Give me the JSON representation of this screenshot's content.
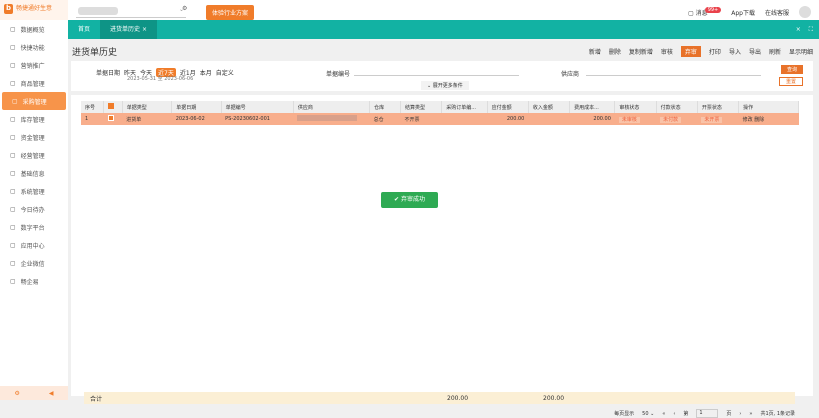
{
  "app": {
    "logo": "畅捷通好生意",
    "sub": "标准版"
  },
  "top": {
    "exp_btn": "体验行业方案",
    "msg": "消息",
    "msg_badge": "99+",
    "app": "App下载",
    "service": "在线客服"
  },
  "sidebar": {
    "items": [
      "数据概览",
      "快捷功能",
      "营销推广",
      "商品管理",
      "采购管理",
      "库存管理",
      "资金管理",
      "经营管理",
      "基础信息",
      "系统管理",
      "今日待办",
      "数字平台",
      "应用中心",
      "企业微信",
      "畅企易"
    ],
    "active": 4
  },
  "tabs": [
    {
      "label": "首页"
    },
    {
      "label": "进货单历史"
    }
  ],
  "page": {
    "title": "进货单历史"
  },
  "toolbar": [
    "新增",
    "删除",
    "复制新增",
    "审核",
    "弃审",
    "打印",
    "导入",
    "导出",
    "刷新",
    "显示明细"
  ],
  "filter": {
    "date_label": "单据日期",
    "ranges": [
      "昨天",
      "今天",
      "近7天",
      "近1月",
      "本月",
      "自定义"
    ],
    "active_range": 2,
    "date_text": "2023-05-31 至 2023-06-06",
    "no_label": "单据编号",
    "supplier_label": "供应商",
    "query": "查询",
    "reset": "重置",
    "more": "展开更多条件"
  },
  "table": {
    "headers": [
      "序号",
      "",
      "单据类型",
      "单据日期",
      "单据编号",
      "供应商",
      "仓库",
      "结算类型",
      "采购订单编...",
      "应付金额",
      "收入金额",
      "费用成本...",
      "审核状态",
      "付款状态",
      "开票状态",
      "操作"
    ],
    "rows": [
      [
        "1",
        "",
        "进货单",
        "2023-06-02",
        "PS-20230602-001",
        "",
        "总仓",
        "不开票",
        "",
        "200.00",
        "",
        "200.00",
        "未审核",
        "未付款",
        "未开票",
        "修改 删除"
      ]
    ]
  },
  "toast": "弃审成功",
  "summary": {
    "label": "合计",
    "amount": "200.00",
    "cost": "200.00"
  },
  "pager": {
    "per_page_label": "每页显示",
    "per_page": "50",
    "page_prefix": "第",
    "page": "1",
    "page_suffix": "页",
    "total": "共1页, 1条记录"
  }
}
